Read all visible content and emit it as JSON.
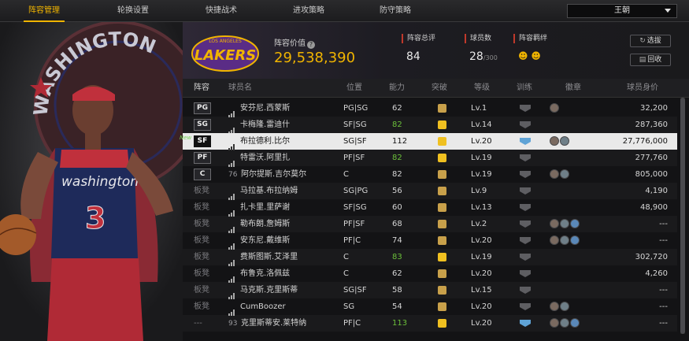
{
  "nav": {
    "tabs": [
      "阵容管理",
      "轮换设置",
      "快捷战术",
      "进攻策略",
      "防守策略"
    ],
    "team_select": "王朝"
  },
  "hero": {
    "arc_text": "WASHINGTON",
    "jersey_text": "washington",
    "jersey_number": "3"
  },
  "header": {
    "logo_text": "LAKERS",
    "logo_subtext": "LOS ANGELES",
    "value_label": "阵容价值",
    "value": "29,538,390",
    "rating_label": "阵容总评",
    "rating": "84",
    "players_label": "球员数",
    "players": "28",
    "players_max": "/300",
    "bond_label": "阵容羁绊",
    "select_btn": "选拔",
    "recycle_btn": "回收"
  },
  "columns": [
    "阵容",
    "球员名",
    "位置",
    "能力",
    "突破",
    "等级",
    "训练",
    "徽章",
    "球员身价"
  ],
  "rows": [
    {
      "slot": "PG",
      "jersey": "",
      "name": "安芬尼.西蒙斯",
      "pos": "PG|SG",
      "ovr": "62",
      "ovr_green": false,
      "brk": "gold",
      "level": "Lv.1",
      "train": "grey",
      "badges": 1,
      "salary": "32,200",
      "new": false,
      "sel": false
    },
    {
      "slot": "SG",
      "jersey": "",
      "name": "卡梅隆.雷迪什",
      "pos": "SF|SG",
      "ovr": "82",
      "ovr_green": true,
      "brk": "crown",
      "level": "Lv.14",
      "train": "grey",
      "badges": 0,
      "salary": "287,360",
      "new": false,
      "sel": false
    },
    {
      "slot": "SF",
      "jersey": "",
      "name": "布拉德利.比尔",
      "pos": "SG|SF",
      "ovr": "112",
      "ovr_green": false,
      "brk": "crown",
      "level": "Lv.20",
      "train": "blue",
      "badges": 2,
      "salary": "27,776,000",
      "new": true,
      "sel": true
    },
    {
      "slot": "PF",
      "jersey": "",
      "name": "特雷沃.阿里扎",
      "pos": "PF|SF",
      "ovr": "82",
      "ovr_green": true,
      "brk": "crown",
      "level": "Lv.19",
      "train": "grey",
      "badges": 0,
      "salary": "277,760",
      "new": false,
      "sel": false
    },
    {
      "slot": "C",
      "jersey": "76",
      "name": "阿尔提斯.吉尔莫尔",
      "pos": "C",
      "ovr": "82",
      "ovr_green": false,
      "brk": "gold",
      "level": "Lv.19",
      "train": "grey",
      "badges": 2,
      "salary": "805,000",
      "new": false,
      "sel": false
    },
    {
      "slot": "板凳",
      "jersey": "",
      "name": "马拉基.布拉纳姆",
      "pos": "SG|PG",
      "ovr": "56",
      "ovr_green": false,
      "brk": "gold",
      "level": "Lv.9",
      "train": "grey",
      "badges": 0,
      "salary": "4,190",
      "new": false,
      "sel": false
    },
    {
      "slot": "板凳",
      "jersey": "",
      "name": "扎卡里.里萨谢",
      "pos": "SF|SG",
      "ovr": "60",
      "ovr_green": false,
      "brk": "gold",
      "level": "Lv.13",
      "train": "grey",
      "badges": 0,
      "salary": "48,900",
      "new": false,
      "sel": false
    },
    {
      "slot": "板凳",
      "jersey": "",
      "name": "勒布朗.詹姆斯",
      "pos": "PF|SF",
      "ovr": "68",
      "ovr_green": false,
      "brk": "gold",
      "level": "Lv.2",
      "train": "grey",
      "badges": 3,
      "salary": "---",
      "new": false,
      "sel": false
    },
    {
      "slot": "板凳",
      "jersey": "",
      "name": "安东尼.戴维斯",
      "pos": "PF|C",
      "ovr": "74",
      "ovr_green": false,
      "brk": "gold",
      "level": "Lv.20",
      "train": "grey",
      "badges": 3,
      "salary": "---",
      "new": false,
      "sel": false
    },
    {
      "slot": "板凳",
      "jersey": "",
      "name": "费斯图斯.艾泽里",
      "pos": "C",
      "ovr": "83",
      "ovr_green": true,
      "brk": "crown",
      "level": "Lv.19",
      "train": "grey",
      "badges": 0,
      "salary": "302,720",
      "new": false,
      "sel": false
    },
    {
      "slot": "板凳",
      "jersey": "",
      "name": "布鲁克.洛佩兹",
      "pos": "C",
      "ovr": "62",
      "ovr_green": false,
      "brk": "gold",
      "level": "Lv.20",
      "train": "grey",
      "badges": 0,
      "salary": "4,260",
      "new": false,
      "sel": false
    },
    {
      "slot": "板凳",
      "jersey": "",
      "name": "马克斯.克里斯蒂",
      "pos": "SG|SF",
      "ovr": "58",
      "ovr_green": false,
      "brk": "gold",
      "level": "Lv.15",
      "train": "grey",
      "badges": 0,
      "salary": "---",
      "new": false,
      "sel": false
    },
    {
      "slot": "板凳",
      "jersey": "",
      "name": "CumBoozer",
      "pos": "SG",
      "ovr": "54",
      "ovr_green": false,
      "brk": "gold",
      "level": "Lv.20",
      "train": "grey",
      "badges": 2,
      "salary": "---",
      "new": false,
      "sel": false
    },
    {
      "slot": "---",
      "jersey": "93",
      "name": "克里斯蒂安.莱特纳",
      "pos": "PF|C",
      "ovr": "113",
      "ovr_green": true,
      "brk": "crown",
      "level": "Lv.20",
      "train": "blue",
      "badges": 3,
      "salary": "---",
      "new": false,
      "sel": false
    }
  ],
  "colors": {
    "accent": "#f0b400",
    "green": "#6bbf3a",
    "selected_row": "#e9e9e9"
  }
}
